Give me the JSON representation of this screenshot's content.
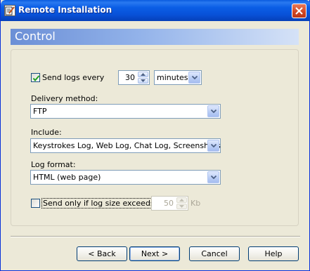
{
  "window": {
    "title": "Remote Installation"
  },
  "header": {
    "title": "Control"
  },
  "send_logs": {
    "checked": true,
    "label": "Send logs every",
    "interval": "30",
    "unit_options_selected": "minutes"
  },
  "delivery": {
    "label": "Delivery method:",
    "value": "FTP"
  },
  "include": {
    "label": "Include:",
    "value": "Keystrokes Log, Web Log, Chat Log, Screenshots"
  },
  "log_format": {
    "label": "Log format:",
    "value": "HTML (web page)"
  },
  "size_limit": {
    "checked": false,
    "label": "Send only if log size exceeds",
    "value": "50",
    "unit": "Kb",
    "enabled": false
  },
  "buttons": {
    "back": "< Back",
    "next": "Next >",
    "cancel": "Cancel",
    "help": "Help"
  },
  "icons": {
    "title": "notepad-pencil-icon",
    "close": "close-icon",
    "check": "checkmark-icon",
    "dropdown": "chevron-down-icon",
    "spin_up": "arrow-up-icon",
    "spin_down": "arrow-down-icon"
  }
}
